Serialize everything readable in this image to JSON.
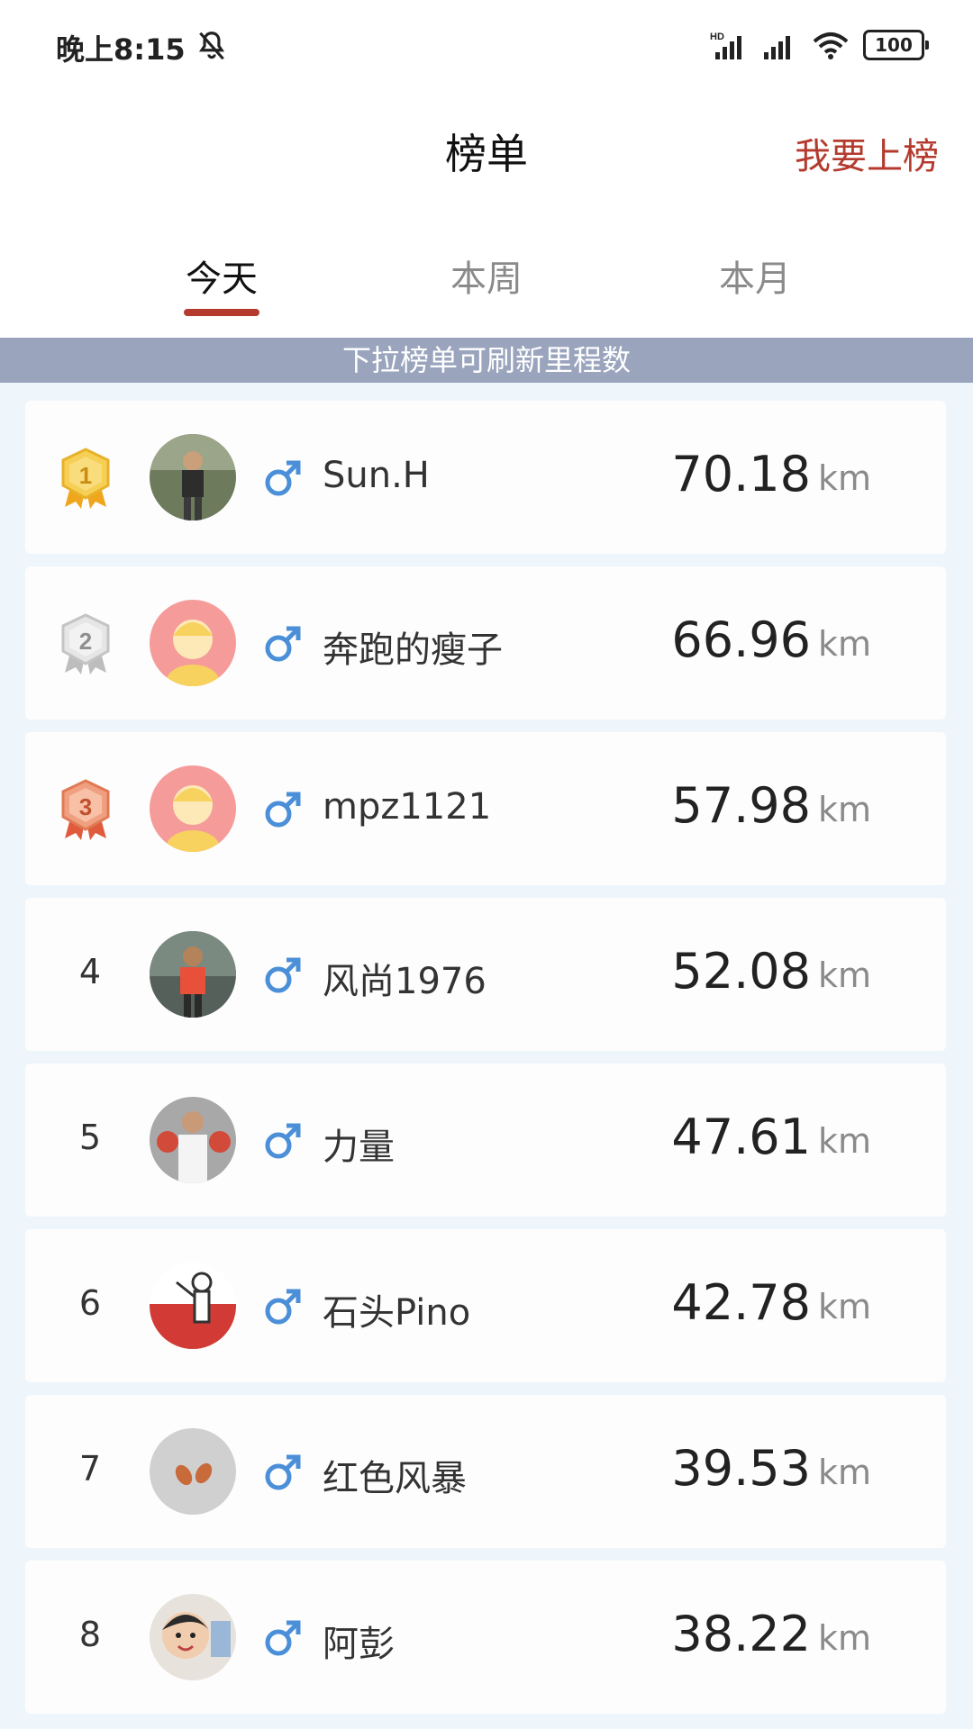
{
  "status_bar": {
    "time": "晚上8:15",
    "battery": "100",
    "icons": [
      "bell-off-icon",
      "hd-signal-icon",
      "signal-icon",
      "wifi-icon",
      "battery-icon"
    ]
  },
  "header": {
    "title": "榜单",
    "action": "我要上榜"
  },
  "tabs": [
    {
      "label": "今天",
      "active": true
    },
    {
      "label": "本周",
      "active": false
    },
    {
      "label": "本月",
      "active": false
    }
  ],
  "hint": "下拉榜单可刷新里程数",
  "colors": {
    "accent": "#b53a2e",
    "hint_bg": "#9aa4bd",
    "male": "#4a8fd8",
    "gold": "#f2c23a",
    "silver": "#c9c9c9",
    "bronze": "#e98a6a"
  },
  "leaderboard": [
    {
      "rank": "1",
      "name": "Sun.H",
      "gender": "♂",
      "distance": "70.18",
      "unit": "km"
    },
    {
      "rank": "2",
      "name": "奔跑的瘦子",
      "gender": "♂",
      "distance": "66.96",
      "unit": "km"
    },
    {
      "rank": "3",
      "name": "mpz1121",
      "gender": "♂",
      "distance": "57.98",
      "unit": "km"
    },
    {
      "rank": "4",
      "name": "风尚1976",
      "gender": "♂",
      "distance": "52.08",
      "unit": "km"
    },
    {
      "rank": "5",
      "name": "力量",
      "gender": "♂",
      "distance": "47.61",
      "unit": "km"
    },
    {
      "rank": "6",
      "name": "石头Pino",
      "gender": "♂",
      "distance": "42.78",
      "unit": "km"
    },
    {
      "rank": "7",
      "name": "红色风暴",
      "gender": "♂",
      "distance": "39.53",
      "unit": "km"
    },
    {
      "rank": "8",
      "name": "阿彭",
      "gender": "♂",
      "distance": "38.22",
      "unit": "km"
    }
  ]
}
